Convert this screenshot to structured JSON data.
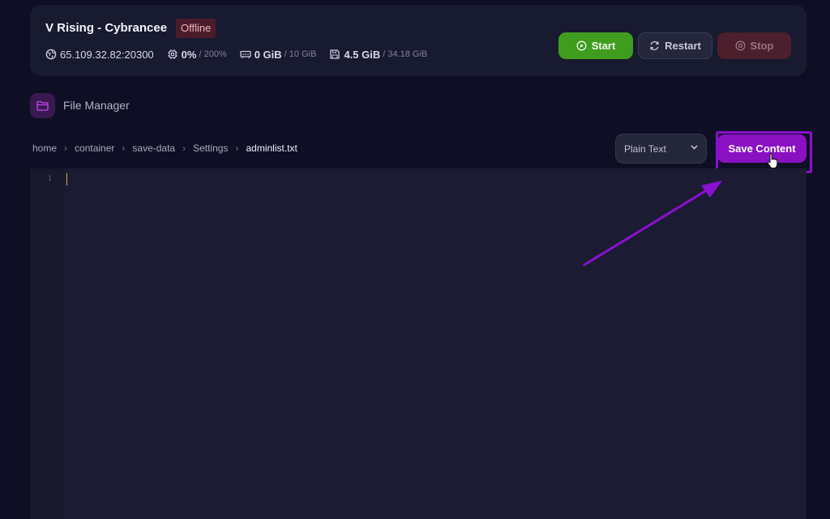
{
  "server": {
    "name": "V Rising - Cybrancee",
    "status": "Offline",
    "address": "65.109.32.82:20300",
    "cpu_value": "0%",
    "cpu_max": "/ 200%",
    "memory_value": "0 GiB",
    "memory_max": "/ 10 GiB",
    "disk_value": "4.5 GiB",
    "disk_max": "/ 34.18 GiB"
  },
  "actions": {
    "start_label": "Start",
    "restart_label": "Restart",
    "stop_label": "Stop"
  },
  "section": {
    "title": "File Manager",
    "icon": "folder-icon"
  },
  "breadcrumb": {
    "items": [
      "home",
      "container",
      "save-data",
      "Settings"
    ],
    "current": "adminlist.txt"
  },
  "editor": {
    "language": "Plain Text",
    "save_label": "Save Content",
    "line_numbers": [
      "1"
    ],
    "content": ""
  },
  "colors": {
    "accent": "#8a10c2",
    "start": "#3f9c1f",
    "stop": "#4b1f2c",
    "offline_badge": "#4a1c2a"
  }
}
